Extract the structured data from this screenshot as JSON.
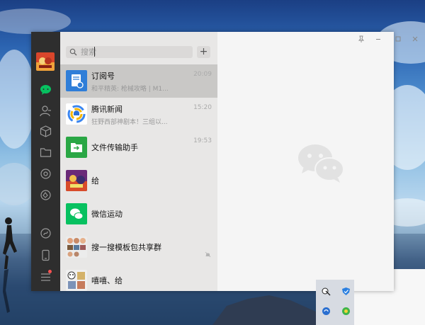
{
  "search": {
    "placeholder": "搜索"
  },
  "add_label": "+",
  "chats": [
    {
      "name": "订阅号",
      "preview": "和平精英: 枪械攻略 | M1...",
      "time": "20:09",
      "avatar_icon": "subscription-icon",
      "active": true
    },
    {
      "name": "腾讯新闻",
      "preview": "狂野西部神剧本！三组以...",
      "time": "15:20",
      "avatar_icon": "tencent-news-icon"
    },
    {
      "name": "文件传输助手",
      "preview": "",
      "time": "19:53",
      "avatar_icon": "file-transfer-icon"
    },
    {
      "name": "给",
      "preview": "",
      "time": "",
      "avatar_icon": "user-avatar"
    },
    {
      "name": "微信运动",
      "preview": "",
      "time": "",
      "avatar_icon": "wechat-sport-icon"
    },
    {
      "name": "搜一搜模板包共享群",
      "preview": "",
      "time": "",
      "avatar_icon": "group-avatar",
      "muted": true
    },
    {
      "name": "嘻嘻、给",
      "preview": "",
      "time": "",
      "avatar_icon": "group-avatar-2"
    }
  ],
  "colors": {
    "sidebar": "#2e2e2e",
    "accent": "#07c160",
    "list_bg": "#e8e7e6",
    "badge": "#fa5151"
  }
}
